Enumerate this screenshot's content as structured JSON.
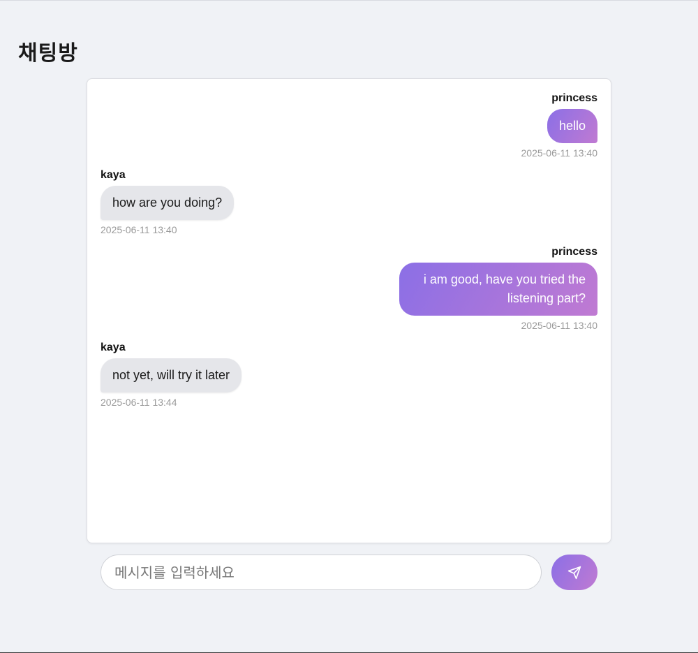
{
  "header": {
    "title": "채팅방"
  },
  "messages": [
    {
      "sender": "princess",
      "text": "hello",
      "time": "2025-06-11 13:40",
      "mine": true
    },
    {
      "sender": "kaya",
      "text": "how are you doing?",
      "time": "2025-06-11 13:40",
      "mine": false
    },
    {
      "sender": "princess",
      "text": "i am good, have you tried the listening part?",
      "time": "2025-06-11 13:40",
      "mine": true
    },
    {
      "sender": "kaya",
      "text": "not yet, will try it later",
      "time": "2025-06-11 13:44",
      "mine": false
    }
  ],
  "composer": {
    "placeholder": "메시지를 입력하세요",
    "value": "",
    "send_icon": "send-icon"
  },
  "colors": {
    "background": "#f0f2f6",
    "accent_start": "#8b6fe6",
    "accent_end": "#c07ad2",
    "other_bubble": "#e5e6ea"
  }
}
